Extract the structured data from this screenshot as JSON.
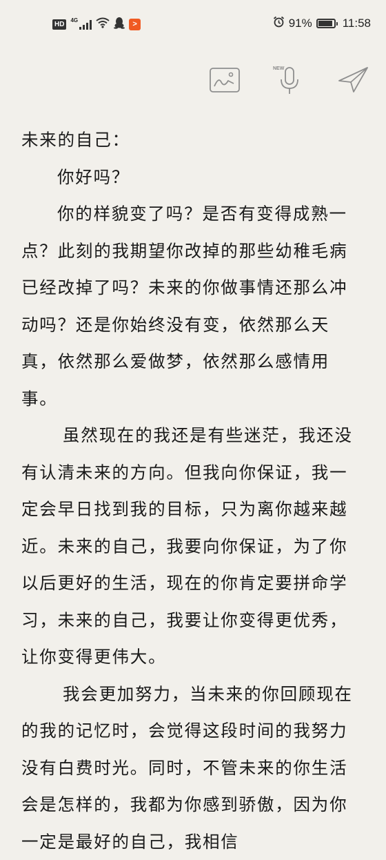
{
  "status_bar": {
    "hd": "HD",
    "network": "4G",
    "battery": "91%",
    "battery_level": 0.91,
    "time": "11:58",
    "icons": [
      "signal-icon",
      "wifi-icon",
      "qq-penguin-icon",
      "play-app-icon",
      "alarm-icon",
      "battery-icon"
    ]
  },
  "toolbar": {
    "new_badge": "NEW",
    "icons": [
      "image-icon",
      "microphone-icon",
      "send-icon"
    ]
  },
  "letter": {
    "greeting": "未来的自己：",
    "paragraphs": [
      "你好吗？",
      "你的样貌变了吗？是否有变得成熟一点？此刻的我期望你改掉的那些幼稚毛病已经改掉了吗？未来的你做事情还那么冲动吗？还是你始终没有变，依然那么天真，依然那么爱做梦，依然那么感情用事。",
      "虽然现在的我还是有些迷茫，我还没有认清未来的方向。但我向你保证，我一定会早日找到我的目标，只为离你越来越近。未来的自己，我要向你保证，为了你以后更好的生活，现在的你肯定要拼命学习，未来的自己，我要让你变得更优秀，让你变得更伟大。",
      "我会更加努力，当未来的你回顾现在的我的记忆时，会觉得这段时间的我努力没有白费时光。同时，不管未来的你生活会是怎样的，我都为你感到骄傲，因为你一定是最好的自己，我相信"
    ]
  }
}
